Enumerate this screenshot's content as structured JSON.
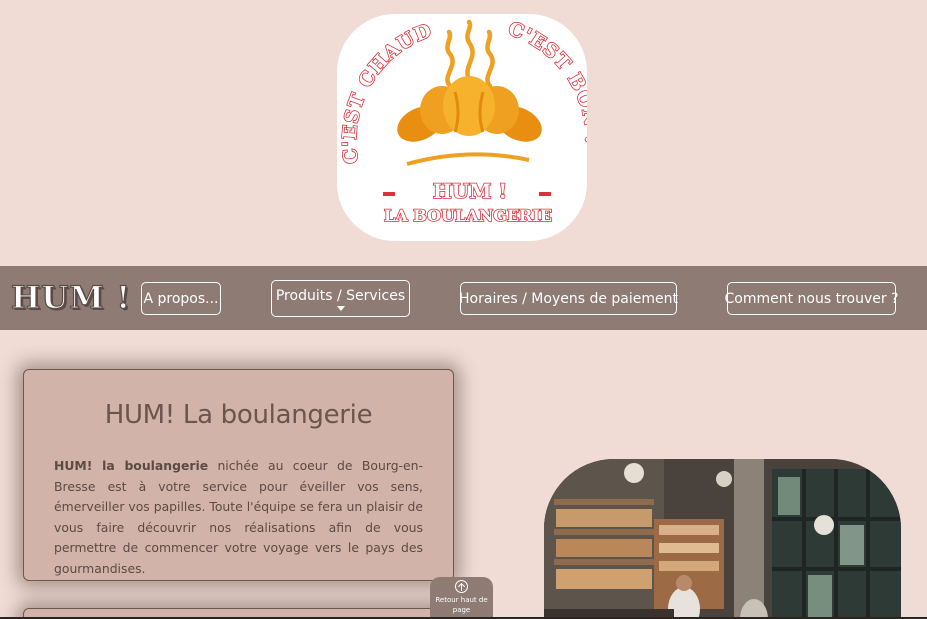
{
  "logo": {
    "arc_left": "C'EST CHAUD !",
    "arc_right": "C'EST BON !",
    "title_line1": "HUM !",
    "title_line2": "LA BOULANGERIE",
    "colors": {
      "red": "#d8313b",
      "orange": "#f0a020",
      "orange_dark": "#e08a10"
    }
  },
  "nav": {
    "brand": "HUM !",
    "items": [
      {
        "label": "A propos..."
      },
      {
        "label": "Produits / Services"
      },
      {
        "label": "Horaires / Moyens de paiement"
      },
      {
        "label": "Comment nous trouver ?"
      }
    ]
  },
  "main": {
    "card": {
      "title": "HUM! La boulangerie",
      "text_bold": "HUM! la boulangerie",
      "text": " nichée au coeur de Bourg-en-Bresse est à votre service pour éveiller vos sens, émerveiller vos papilles. Toute l'équipe se fera un plaisir de vous faire découvrir nos réalisations afin de vous permettre de commencer votre voyage vers le pays des gourmandises."
    }
  },
  "back_to_top": {
    "label": "Retour haut de page",
    "icon": "arrow-up-circle-icon"
  },
  "colors": {
    "page_bg": "#f0dcd5",
    "nav_bg": "#8e7b74",
    "card_bg": "#d2b3a9",
    "text": "#5c4a45"
  }
}
